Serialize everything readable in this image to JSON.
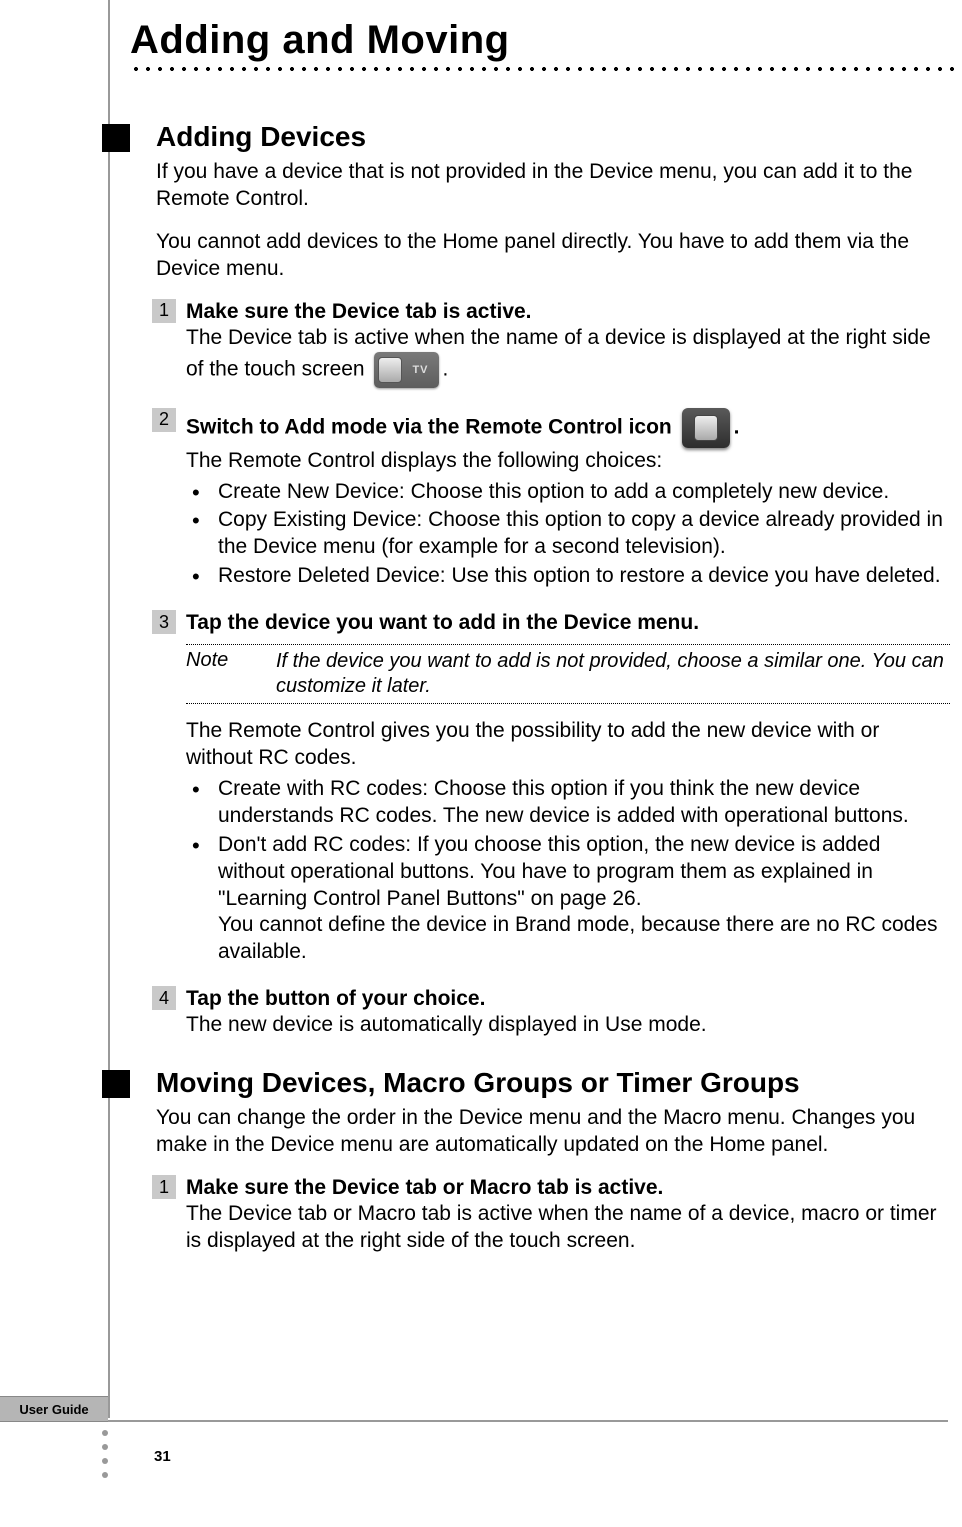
{
  "chapter_title": "Adding and Moving",
  "footer": {
    "tab": "User Guide",
    "page_number": "31"
  },
  "icons": {
    "tv_label": "TV"
  },
  "sections": {
    "adding": {
      "title": "Adding Devices",
      "intro1": "If you have a device that is not provided in the Device menu, you can add it to the Remote Control.",
      "intro2": "You cannot add devices to the Home panel directly. You have to add them via the Device menu.",
      "step1": {
        "num": "1",
        "title": "Make sure the Device tab is active.",
        "body_pre": "The Device tab is active when the name of a device is displayed at the right side of the touch screen ",
        "body_post": "."
      },
      "step2": {
        "num": "2",
        "title_pre": "Switch to Add mode via the Remote Control icon ",
        "title_post": ".",
        "body": "The Remote Control displays the following choices:",
        "bullets": [
          "Create New Device: Choose this option to add a completely new device.",
          "Copy Existing Device: Choose this option to copy a device already provided in the Device menu (for example for a second television).",
          "Restore Deleted Device: Use this option to restore a device you have deleted."
        ]
      },
      "step3": {
        "num": "3",
        "title": "Tap the device you want to add in the Device menu.",
        "note_label": "Note",
        "note_text": "If the device you want to add is not provided, choose a similar one. You can customize it later.",
        "body": "The Remote Control gives you the possibility to add the new device with or without RC codes.",
        "bullets": [
          "Create with RC codes: Choose this option if you think the new device understands RC codes. The new device is added with operational buttons.",
          "Don't add RC codes: If you choose this option, the new device is added without operational buttons. You have to program them as explained in \"Learning Control Panel Buttons\" on page 26.\nYou cannot define the device in Brand mode, because there are no RC codes available."
        ]
      },
      "step4": {
        "num": "4",
        "title": "Tap the button of your choice.",
        "body": "The new device is automatically displayed in Use mode."
      }
    },
    "moving": {
      "title": "Moving Devices, Macro Groups or Timer Groups",
      "intro": "You can change the order in the Device menu and the Macro menu. Changes you make in the Device menu are automatically updated on the Home panel.",
      "step1": {
        "num": "1",
        "title": "Make sure the Device tab or Macro tab is active.",
        "body": "The Device tab or Macro tab is active when the name of a device, macro or timer is displayed at the right side of the touch screen."
      }
    }
  }
}
